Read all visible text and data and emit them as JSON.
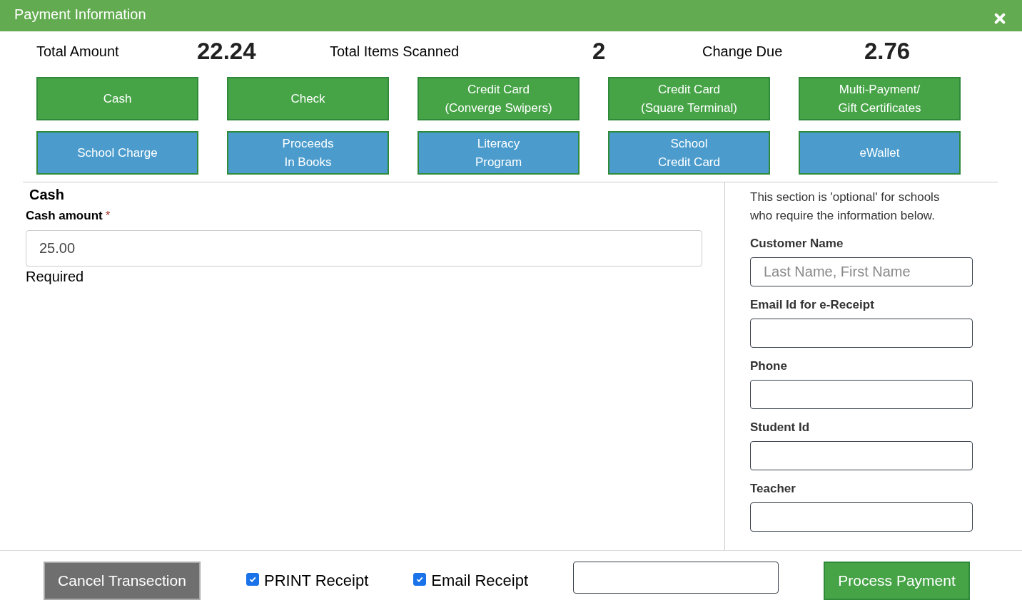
{
  "window": {
    "title": "Payment Information"
  },
  "summary": [
    {
      "label": "Total Amount",
      "value": "22.24"
    },
    {
      "label": "Total Items Scanned",
      "value": "2"
    },
    {
      "label": "Change Due",
      "value": "2.76"
    }
  ],
  "payment_methods": [
    {
      "label": "Cash",
      "kind": "primary"
    },
    {
      "label": "Check",
      "kind": "primary"
    },
    {
      "label": "Credit Card\n(Converge Swipers)",
      "kind": "primary"
    },
    {
      "label": "Credit Card\n(Square Terminal)",
      "kind": "primary"
    },
    {
      "label": "Multi-Payment/\nGift Certificates",
      "kind": "primary"
    },
    {
      "label": "School Charge",
      "kind": "secondary"
    },
    {
      "label": "Proceeds\nIn Books",
      "kind": "secondary"
    },
    {
      "label": "Literacy\nProgram",
      "kind": "secondary"
    },
    {
      "label": "School\nCredit Card",
      "kind": "secondary"
    },
    {
      "label": "eWallet",
      "kind": "secondary"
    }
  ],
  "cash_section": {
    "title": "Cash",
    "field_label": "Cash amount",
    "required_mark": "*",
    "value": "25.00",
    "validation": "Required"
  },
  "customer_section": {
    "note": "This section is 'optional' for schools who require the information below.",
    "fields": [
      {
        "label": "Customer Name",
        "placeholder": "Last Name, First Name"
      },
      {
        "label": "Email Id for e-Receipt"
      },
      {
        "label": "Phone"
      },
      {
        "label": "Student Id"
      },
      {
        "label": "Teacher"
      }
    ]
  },
  "footer": {
    "cancel_button": "Cancel Transection",
    "options": [
      {
        "label": "PRINT Receipt",
        "checked": true
      },
      {
        "label": "Email Receipt",
        "checked": true
      }
    ],
    "process_button": "Process Payment"
  }
}
